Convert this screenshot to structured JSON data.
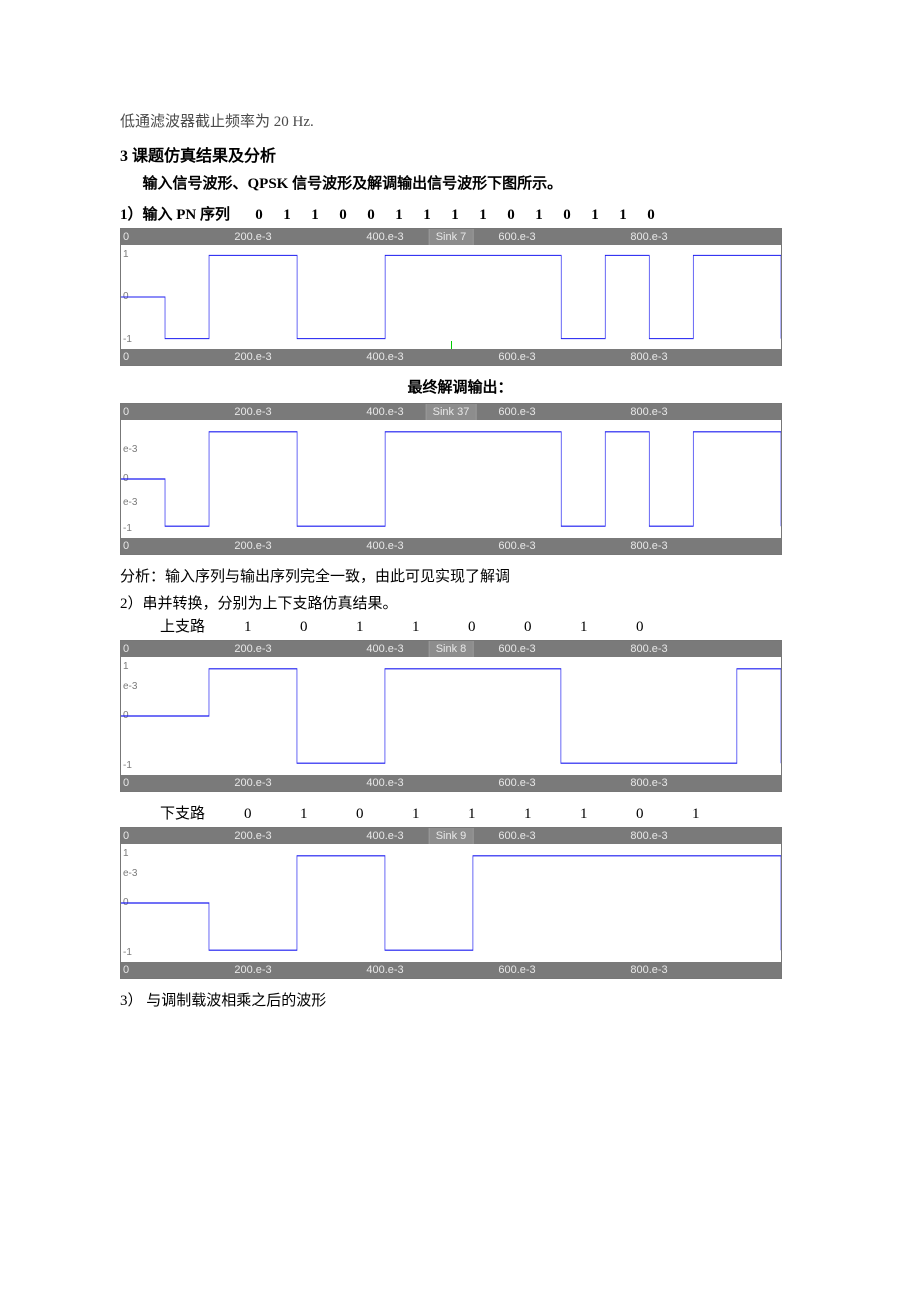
{
  "texts": {
    "gray_line": "低通滤波器截止频率为 20 Hz.",
    "section3": "3 课题仿真结果及分析",
    "intro": "输入信号波形、QPSK 信号波形及解调输出信号波形下图所示。",
    "item1_prefix": "1）输入 PN 序列",
    "center_demod": "最终解调输出：",
    "analysis": "分析：输入序列与输出序列完全一致，由此可见实现了解调",
    "item2": "2）串并转换，分别为上下支路仿真结果。",
    "upper_label": "上支路",
    "lower_label": "下支路",
    "item3": "3） 与调制载波相乘之后的波形"
  },
  "sequences": {
    "pn": [
      "0",
      "1",
      "1",
      "0",
      "0",
      "1",
      "1",
      "1",
      "1",
      "0",
      "1",
      "0",
      "1",
      "1",
      "0"
    ],
    "upper": [
      "1",
      "0",
      "1",
      "1",
      "0",
      "0",
      "1",
      "0"
    ],
    "lower": [
      "0",
      "1",
      "0",
      "1",
      "1",
      "1",
      "1",
      "0",
      "1"
    ]
  },
  "chart_axis": {
    "ticks": [
      "0",
      "200.e-3",
      "400.e-3",
      "600.e-3",
      "800.e-3"
    ]
  },
  "chart_data": [
    {
      "id": "sink7",
      "type": "line",
      "title": "Sink 7",
      "xlabel": "",
      "ylabel": "",
      "ylim": [
        -1,
        1
      ],
      "yticks": [
        "1",
        "0",
        "-1"
      ],
      "x_ticks": [
        "0",
        "200.e-3",
        "400.e-3",
        "600.e-3",
        "800.e-3"
      ],
      "step_ms": 66.7,
      "bits": [
        0,
        1,
        1,
        0,
        0,
        1,
        1,
        1,
        1,
        0,
        1,
        0,
        1,
        1,
        0
      ],
      "levels": {
        "0": -1,
        "1": 1
      },
      "initial_level": 0,
      "note": "NRZ bipolar, starts at 0 then bit levels"
    },
    {
      "id": "sink37",
      "type": "line",
      "title": "Sink 37",
      "xlabel": "",
      "ylabel": "",
      "ylim": [
        -1,
        1
      ],
      "yticks": [
        "e-3",
        "0",
        "e-3",
        "-1"
      ],
      "x_ticks": [
        "0",
        "200.e-3",
        "400.e-3",
        "600.e-3",
        "800.e-3"
      ],
      "step_ms": 66.7,
      "bits": [
        0,
        1,
        1,
        0,
        0,
        1,
        1,
        1,
        1,
        0,
        1,
        0,
        1,
        1,
        0
      ],
      "levels": {
        "0": -1,
        "1": 1
      },
      "initial_level": 0,
      "note": "Demodulated output, identical to input with slight ringing"
    },
    {
      "id": "sink8",
      "type": "line",
      "title": "Sink 8",
      "xlabel": "",
      "ylabel": "",
      "ylim": [
        -1,
        1
      ],
      "yticks": [
        "1",
        "e-3",
        "0",
        "-1"
      ],
      "x_ticks": [
        "0",
        "200.e-3",
        "400.e-3",
        "600.e-3",
        "800.e-3"
      ],
      "step_ms": 133.3,
      "bits": [
        1,
        0,
        1,
        1,
        0,
        0,
        1,
        0
      ],
      "levels": {
        "0": -1,
        "1": 1
      },
      "initial_level": 0,
      "note": "Upper I-branch after serial-to-parallel"
    },
    {
      "id": "sink9",
      "type": "line",
      "title": "Sink 9",
      "xlabel": "",
      "ylabel": "",
      "ylim": [
        -1,
        1
      ],
      "yticks": [
        "1",
        "e-3",
        "0",
        "-1"
      ],
      "x_ticks": [
        "0",
        "200.e-3",
        "400.e-3",
        "600.e-3",
        "800.e-3"
      ],
      "step_ms": 133.3,
      "bits": [
        0,
        1,
        0,
        1,
        1,
        1,
        1,
        0,
        1
      ],
      "levels": {
        "0": -1,
        "1": 1
      },
      "initial_level": 0,
      "note": "Lower Q-branch after serial-to-parallel; 9th bit partial at right edge"
    }
  ]
}
